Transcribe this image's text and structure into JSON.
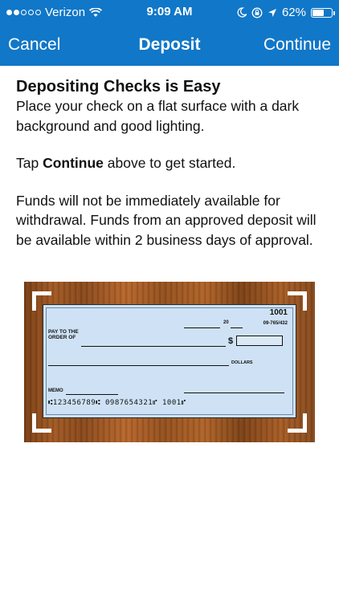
{
  "status_bar": {
    "carrier": "Verizon",
    "time": "9:09 AM",
    "battery": "62%",
    "battery_level": 0.62,
    "icons": [
      "signal-dots",
      "wifi-icon",
      "moon-icon",
      "lock-rotation-icon",
      "location-arrow-icon",
      "battery-icon"
    ]
  },
  "nav": {
    "cancel_label": "Cancel",
    "title": "Deposit",
    "continue_label": "Continue"
  },
  "content": {
    "heading": "Depositing Checks is Easy",
    "intro": "Place your check on a flat surface with a dark background and good lighting.",
    "tap_prefix": "Tap ",
    "tap_bold": "Continue",
    "tap_suffix": " above to get started.",
    "funds_note": "Funds will not be immediately available for withdrawal. Funds from an approved deposit will be available within 2 business days of approval."
  },
  "check": {
    "number": "1001",
    "date_year": "20",
    "routing_fraction": "09-765/432",
    "pay_to": "PAY TO THE ORDER OF",
    "dollar_sign": "$",
    "dollars": "DOLLARS",
    "memo": "MEMO",
    "micr": "⑆123456789⑆  0987654321⑈  1001⑈"
  }
}
